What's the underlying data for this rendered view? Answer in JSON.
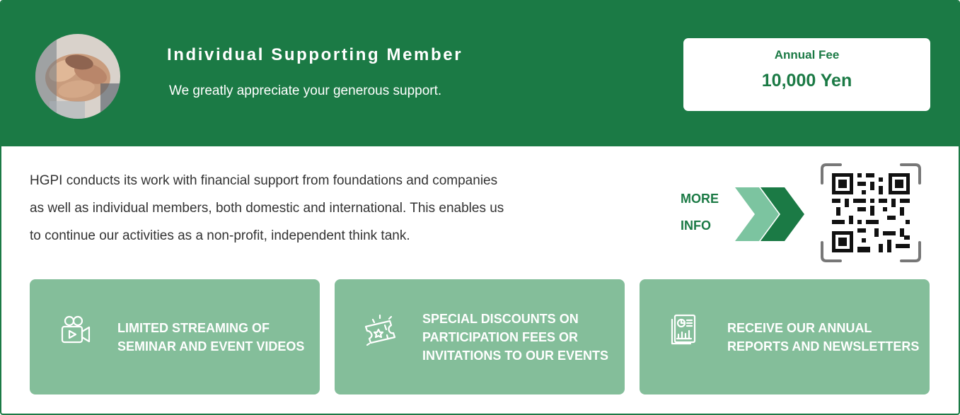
{
  "header": {
    "title": "Individual Supporting Member",
    "subtitle": "We greatly appreciate your generous support."
  },
  "fee": {
    "label": "Annual Fee",
    "value": "10,000 Yen"
  },
  "description": {
    "lines": [
      "HGPI conducts its work with financial support from foundations and companies",
      "as well as individual members, both domestic and international. This enables us",
      "to continue our activities as a non-profit, independent think tank."
    ]
  },
  "more_info": {
    "line1": "MORE",
    "line2": "INFO"
  },
  "features": [
    {
      "icon": "video-camera-icon",
      "label": "LIMITED STREAMING OF SEMINAR AND EVENT VIDEOS"
    },
    {
      "icon": "ticket-icon",
      "label": "SPECIAL DISCOUNTS ON PARTICIPATION FEES OR INVITATIONS TO OUR EVENTS"
    },
    {
      "icon": "report-icon",
      "label": "RECEIVE OUR ANNUAL REPORTS AND NEWSLETTERS"
    }
  ],
  "colors": {
    "brand_green": "#1b7a45",
    "light_green": "#84be9a",
    "chevron_light": "#7cc4a0"
  }
}
